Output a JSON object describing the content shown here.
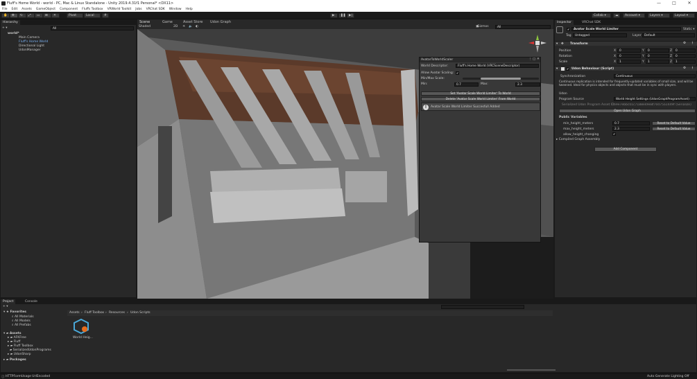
{
  "window": {
    "title": "Fluff's Home World - world - PC, Mac & Linux Standalone - Unity 2019.4.31f1 Personal* <DX11>",
    "minimize": "—",
    "maximize": "□",
    "close": "✕"
  },
  "menu": [
    "File",
    "Edit",
    "Assets",
    "GameObject",
    "Component",
    "Fluffs Toolbox",
    "VRWorld Toolkit",
    "Jobs",
    "VRChat SDK",
    "Window",
    "Help"
  ],
  "toolbar": {
    "pivot": "Pivot",
    "local": "Local",
    "play": "▶",
    "pause": "❚❚",
    "step": "▶|",
    "collab": "Collab ▾",
    "account": "Account ▾",
    "layers": "Layers ▾",
    "layout": "Layout ▾"
  },
  "hierarchy": {
    "tab": "Hierarchy",
    "add": "+ ▾",
    "search_placeholder": "All",
    "items": [
      "world*",
      "Main Camera",
      "Fluff's Home World",
      "Directional Light",
      "UdonManager"
    ]
  },
  "scene": {
    "tabs": [
      "Scene",
      "Game",
      "Asset Store",
      "Udon Graph"
    ],
    "shading": "Shaded",
    "mode_2d": "2D",
    "gizmos": "Gizmos",
    "search_placeholder": "All"
  },
  "popup": {
    "title": "AvatarToWorldScaler",
    "world_descriptor_label": "World Descriptor:",
    "world_descriptor_value": "Fluff's Home World (VRCSceneDescriptor)",
    "allow_scaling_label": "Allow Avatar Scaling:",
    "minmax_label": "Min/Max Scale:",
    "slider_low": 0.7,
    "slider_high": 2.3,
    "min_label": "Min:",
    "min_value": "0.7",
    "max_label": "Max:",
    "max_value": "2.3",
    "set_button": "Set 'Avatar Scale World Limiter' To World",
    "delete_button": "Delete 'Avatar Scale World Limiter' From World",
    "info_text": "Avatar Scale World Limiter Succesfull Added"
  },
  "inspector": {
    "tabs": [
      "Inspector",
      "VRChat SDK"
    ],
    "object_name": "Avatar Scale World Limiter",
    "static": "Static ▾",
    "tag_label": "Tag",
    "tag_value": "Untagged",
    "layer_label": "Layer",
    "layer_value": "Default",
    "transform": {
      "title": "Transform",
      "rows": [
        {
          "label": "Position",
          "x": "0",
          "y": "0",
          "z": "0"
        },
        {
          "label": "Rotation",
          "x": "0",
          "y": "0",
          "z": "0"
        },
        {
          "label": "Scale",
          "x": "1",
          "y": "1",
          "z": "1"
        }
      ]
    },
    "udon": {
      "title": "Udon Behaviour (Script)",
      "sync_label": "Synchronization",
      "sync_value": "Continuous",
      "sync_help": "Continuous replication is intended for frequently-updated variables of small size, and will be tweened. Ideal for physics objects and objects that must be in sync with players.",
      "udon_label": "Udon",
      "program_source_label": "Program Source",
      "program_source_value": "World Height Settings (UdonGraphProgramAsset)",
      "serialized_label": "Serialized Udon Program Asset ID",
      "serialized_value": "69e7ebbc01c7188e49e8f70d75a1449f (Serialize)",
      "open_graph": "Open Udon Graph",
      "public_vars": "Public Variables",
      "vars": [
        {
          "name": "min_height_meters",
          "value": "0.7",
          "reset": "Reset to Default Value"
        },
        {
          "name": "max_height_meters",
          "value": "2.3",
          "reset": "Reset to Default Value"
        },
        {
          "name": "allow_height_changing",
          "value": "✔"
        }
      ],
      "compiled": "Compiled Graph Assembly"
    },
    "add_component": "Add Component"
  },
  "project": {
    "tabs": [
      "Project",
      "Console"
    ],
    "add": "+ ▾",
    "favorites": "Favorites",
    "fav_items": [
      "All Materials",
      "All Models",
      "All Prefabs"
    ],
    "assets": "Assets",
    "asset_items": [
      "AFKFree",
      "Fluff",
      "Fluff Toolbox",
      "SerializedUdonPrograms",
      "UdonSharp"
    ],
    "packages": "Packages",
    "breadcrumb": [
      "Assets",
      "Fluff Toolbox",
      "Resources",
      "Udon Scripts"
    ],
    "asset_file": "World Heig..."
  },
  "status": {
    "left": "HTTPFormUsage UrlEncoded",
    "right": "Auto Generate Lighting Off"
  }
}
